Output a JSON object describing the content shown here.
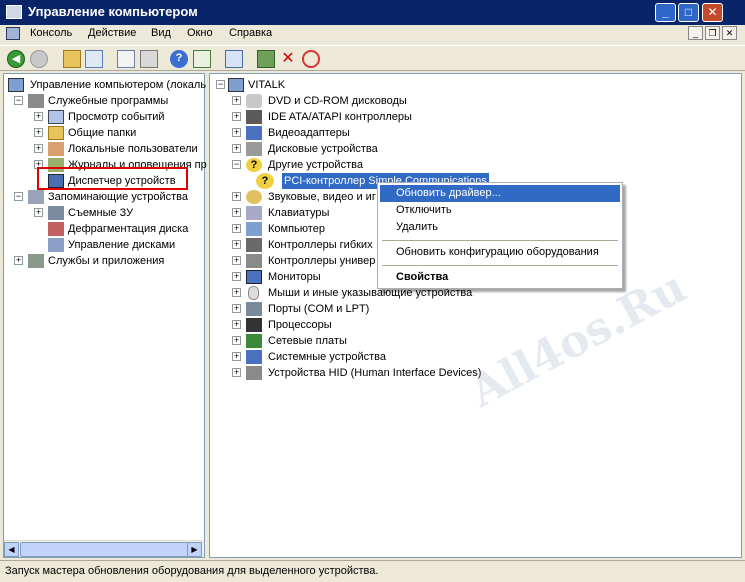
{
  "window": {
    "title": "Управление компьютером",
    "colors": {
      "titlebar": "#0a246a",
      "close": "#c44a2c",
      "selection": "#316ac5"
    }
  },
  "menubar": [
    "Консоль",
    "Действие",
    "Вид",
    "Окно",
    "Справка"
  ],
  "toolbar_icons": [
    "back-icon",
    "forward-icon",
    "up-folder-icon",
    "show-tree-icon",
    "properties-icon",
    "print-icon",
    "help-icon",
    "export-icon",
    "scan-hardware-icon",
    "update-driver-icon",
    "uninstall-icon",
    "disable-icon"
  ],
  "left_tree": {
    "root": "Управление компьютером (локаль",
    "items": [
      "Служебные программы",
      "Просмотр событий",
      "Общие папки",
      "Локальные пользователи",
      "Журналы и оповещения пр",
      "Диспетчер устройств",
      "Запоминающие устройства",
      "Съемные ЗУ",
      "Дефрагментация диска",
      "Управление дисками",
      "Службы и приложения"
    ]
  },
  "right_tree": {
    "root": "VITALK",
    "items": [
      "DVD и CD-ROM дисководы",
      "IDE ATA/ATAPI контроллеры",
      "Видеоадаптеры",
      "Дисковые устройства",
      "Другие устройства",
      "PCI-контроллер Simple Communications",
      "Звуковые, видео и иг",
      "Клавиатуры",
      "Компьютер",
      "Контроллеры гибких",
      "Контроллеры универ",
      "Мониторы",
      "Мыши и иные указывающие устройства",
      "Порты (COM и LPT)",
      "Процессоры",
      "Сетевые платы",
      "Системные устройства",
      "Устройства HID (Human Interface Devices)"
    ]
  },
  "context_menu": {
    "update_driver": "Обновить драйвер...",
    "disable": "Отключить",
    "delete": "Удалить",
    "scan": "Обновить конфигурацию оборудования",
    "properties": "Свойства"
  },
  "status": "Запуск мастера обновления оборудования для выделенного устройства.",
  "watermark": "All4os.Ru"
}
